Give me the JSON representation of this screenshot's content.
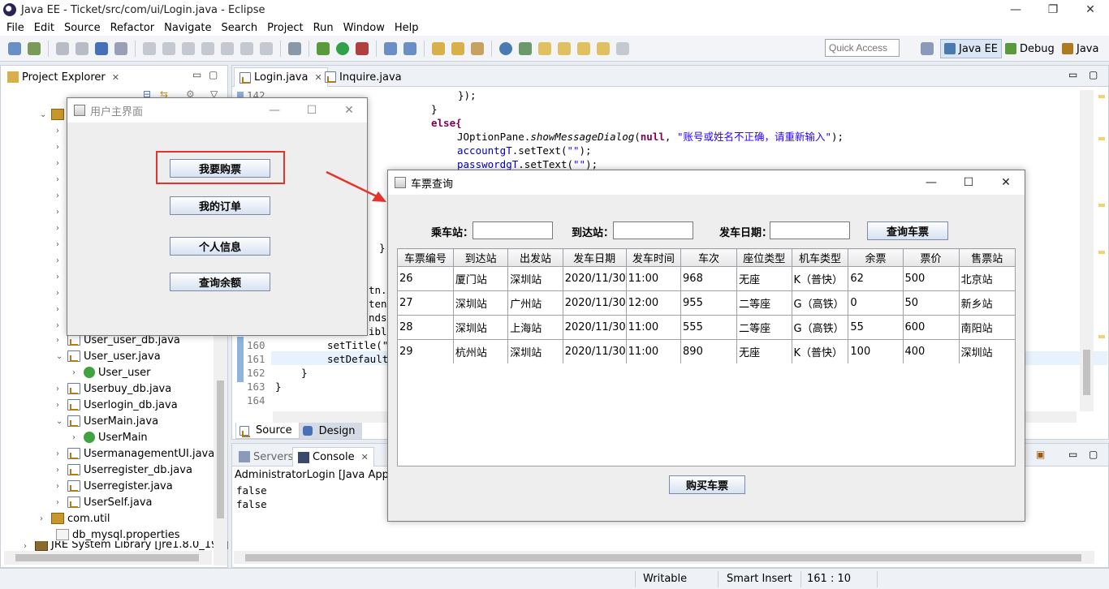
{
  "window": {
    "title": "Java EE - Ticket/src/com/ui/Login.java - Eclipse"
  },
  "menu": [
    "File",
    "Edit",
    "Source",
    "Refactor",
    "Navigate",
    "Search",
    "Project",
    "Run",
    "Window",
    "Help"
  ],
  "toolbar": {
    "quick_access": "Quick Access",
    "perspectives": [
      "Java EE",
      "Debug",
      "Java"
    ]
  },
  "project_explorer": {
    "tab_label": "Project Explorer",
    "items": [
      {
        "label": "User_user_db.java",
        "type": "java"
      },
      {
        "label": "User_user.java",
        "type": "java"
      },
      {
        "label": "User_user",
        "type": "class"
      },
      {
        "label": "Userbuy_db.java",
        "type": "java"
      },
      {
        "label": "Userlogin_db.java",
        "type": "java"
      },
      {
        "label": "UserMain.java",
        "type": "java"
      },
      {
        "label": "UserMain",
        "type": "class"
      },
      {
        "label": "UsermanagementUI.java",
        "type": "java"
      },
      {
        "label": "Userregister_db.java",
        "type": "java"
      },
      {
        "label": "Userregister.java",
        "type": "java"
      },
      {
        "label": "UserSelf.java",
        "type": "java"
      },
      {
        "label": "com.util",
        "type": "package"
      },
      {
        "label": "db_mysql.properties",
        "type": "prop"
      },
      {
        "label": "JRE System Library [jre1.8.0_191]",
        "type": "lib"
      }
    ]
  },
  "editor": {
    "tabs": [
      "Login.java",
      "Inquire.java"
    ],
    "code": {
      "l142_num": "142",
      "l142": "});",
      "l143": "}",
      "l144": "else{",
      "l145_call": "JOptionPane.",
      "l145_method": "showMessageDialog",
      "l145_open": "(",
      "l145_null": "null",
      "l145_sep": ", ",
      "l145_str": "\"账号或姓名不正确，请重新输入\"",
      "l145_end": ");",
      "l146_field": "accountgT",
      "l146_rest": ".setText(",
      "l146_str": "\"\"",
      "l146_end": ");",
      "l147_field": "passwordgT",
      "l147_rest": ".setText(",
      "l147_str": "\"\"",
      "l147_end": ");",
      "b1": "}",
      "b2": "tn.s",
      "b3": "tent",
      "b4": "nds",
      "b5": "ible",
      "l160_num": "160",
      "l160": "setTitle(\"",
      "l161_num": "161",
      "l161": "setDefault",
      "l162_num": "162",
      "l162": "}",
      "l163_num": "163",
      "l163": "}",
      "l164_num": "164"
    },
    "bottom_tabs": [
      "Source",
      "Design"
    ]
  },
  "console": {
    "tabs": [
      "Servers",
      "Console"
    ],
    "launch_label": "AdministratorLogin [Java Applica",
    "output": [
      "false",
      "false"
    ]
  },
  "statusbar": {
    "writable": "Writable",
    "insert_mode": "Smart Insert",
    "position": "161 : 10"
  },
  "user_main_window": {
    "title": "用户主界面",
    "buttons": [
      "我要购票",
      "我的订单",
      "个人信息",
      "查询余额"
    ]
  },
  "ticket_window": {
    "title": "车票查询",
    "labels": {
      "from": "乘车站：",
      "to": "到达站：",
      "date": "发车日期："
    },
    "search_button": "查询车票",
    "buy_button": "购买车票",
    "columns": [
      "车票编号",
      "到达站",
      "出发站",
      "发车日期",
      "发车时间",
      "车次",
      "座位类型",
      "机车类型",
      "余票",
      "票价",
      "售票站"
    ],
    "rows": [
      [
        "26",
        "厦门站",
        "深圳站",
        "2020/11/30",
        "11:00",
        "968",
        "无座",
        "K（普快）",
        "62",
        "500",
        "北京站"
      ],
      [
        "27",
        "深圳站",
        "广州站",
        "2020/11/30",
        "12:00",
        "955",
        "二等座",
        "G（高铁）",
        "0",
        "50",
        "新乡站"
      ],
      [
        "28",
        "深圳站",
        "上海站",
        "2020/11/30",
        "11:00",
        "555",
        "二等座",
        "G（高铁）",
        "55",
        "600",
        "南阳站"
      ],
      [
        "29",
        "杭州站",
        "深圳站",
        "2020/11/30",
        "11:00",
        "890",
        "无座",
        "K（普快）",
        "100",
        "400",
        "深圳站"
      ]
    ]
  },
  "colors": {
    "annotation_red": "#e6342c",
    "keyword": "#7f0055",
    "string": "#2a00ff",
    "field": "#0000c0"
  }
}
